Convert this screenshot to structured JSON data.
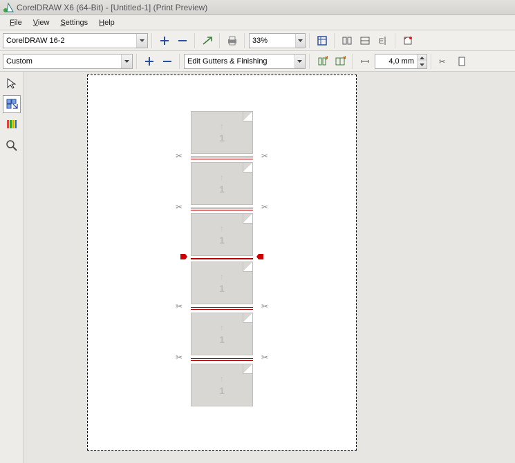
{
  "app": {
    "title": "CorelDRAW X6 (64-Bit) - [Untitled-1] (Print Preview)"
  },
  "menu": {
    "file": "File",
    "view": "View",
    "settings": "Settings",
    "help": "Help"
  },
  "toolbar1": {
    "preset": "CorelDRAW 16-2",
    "zoom": "33%"
  },
  "toolbar2": {
    "layout": "Custom",
    "gutters_label": "Edit Gutters & Finishing",
    "gutter_value": "4,0 mm"
  },
  "preview": {
    "cards": [
      {
        "number": "1"
      },
      {
        "number": "1"
      },
      {
        "number": "1"
      },
      {
        "number": "1"
      },
      {
        "number": "1"
      },
      {
        "number": "1"
      }
    ]
  }
}
